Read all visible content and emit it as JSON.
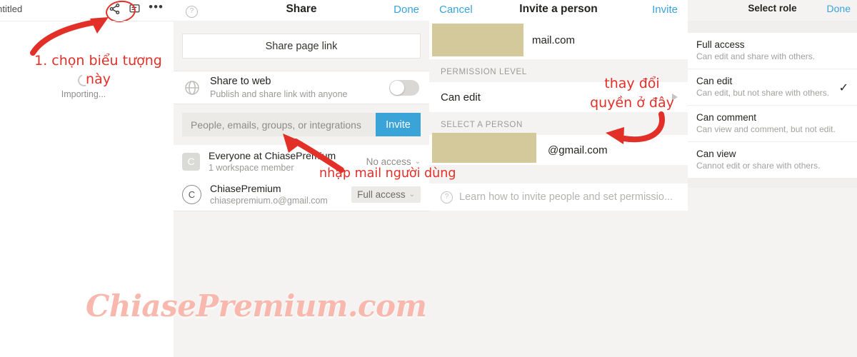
{
  "app": {
    "document_title": "ntitled",
    "importing_label": "Importing...",
    "icons": {
      "share": "share-icon",
      "comment": "comment-icon",
      "more": "more-options-icon"
    }
  },
  "share_panel": {
    "help_icon": "help-icon",
    "title": "Share",
    "done_label": "Done",
    "share_page_link_label": "Share page link",
    "share_to_web": {
      "icon": "globe-icon",
      "title": "Share to web",
      "subtitle": "Publish and share link with anyone",
      "toggle_on": false
    },
    "invite_input_placeholder": "People, emails, groups, or integrations",
    "invite_button_label": "Invite",
    "people": [
      {
        "avatar_letter": "C",
        "avatar_shape": "square",
        "name": "Everyone at ChiasePremium",
        "sub": "1 workspace member",
        "role": "No access",
        "role_boxed": false
      },
      {
        "avatar_letter": "C",
        "avatar_shape": "circle",
        "name": "ChiasePremium",
        "sub": "chiasepremium.o@gmail.com",
        "role": "Full access",
        "role_boxed": true
      }
    ]
  },
  "invite_panel": {
    "cancel_label": "Cancel",
    "title": "Invite a person",
    "invite_label": "Invite",
    "email_value": "mail.com",
    "permission_section_label": "PERMISSION LEVEL",
    "permission_value": "Can edit",
    "select_person_section_label": "SELECT A PERSON",
    "person_email": "@gmail.com",
    "learn_icon": "help-icon",
    "learn_label": "Learn how to invite people and set permissio..."
  },
  "role_panel": {
    "title": "Select role",
    "done_label": "Done",
    "roles": [
      {
        "name": "Full access",
        "desc": "Can edit and share with others.",
        "selected": false
      },
      {
        "name": "Can edit",
        "desc": "Can edit, but not share with others.",
        "selected": true
      },
      {
        "name": "Can comment",
        "desc": "Can view and comment, but not edit.",
        "selected": false
      },
      {
        "name": "Can view",
        "desc": "Cannot edit or share with others.",
        "selected": false
      }
    ],
    "check_glyph": "✓"
  },
  "annotations": {
    "step1": "1. chọn biểu tượng này",
    "step2": "nhập mail người dùng",
    "step3": "thay đổi quyền ở đây"
  },
  "watermark": "ChiasePremium.com",
  "colors": {
    "accent_blue": "#3aa3d8",
    "annotation_red": "#e22f28",
    "redaction": "#d3c99a",
    "panel_bg": "#f4f3f1",
    "watermark": "#f8b8ae"
  }
}
